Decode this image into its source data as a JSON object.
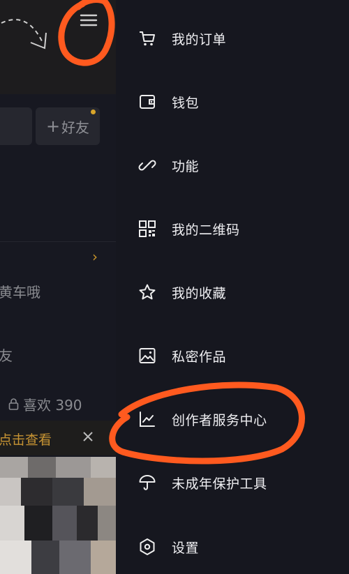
{
  "background": {
    "add_friend_label": "好友",
    "row1_text": "黄车哦",
    "row2_text": "友",
    "likes_text": "喜欢 390",
    "banner_text": "点击查看"
  },
  "drawer": {
    "items": [
      {
        "label": "我的订单",
        "icon": "shopping-cart-icon"
      },
      {
        "label": "钱包",
        "icon": "wallet-icon"
      },
      {
        "label": "功能",
        "icon": "link-icon"
      },
      {
        "label": "我的二维码",
        "icon": "qr-code-icon"
      },
      {
        "label": "我的收藏",
        "icon": "star-icon"
      },
      {
        "label": "私密作品",
        "icon": "image-icon"
      },
      {
        "label": "创作者服务中心",
        "icon": "chart-icon"
      },
      {
        "label": "未成年保护工具",
        "icon": "umbrella-icon"
      },
      {
        "label": "设置",
        "icon": "hexagon-settings-icon"
      }
    ]
  },
  "colors": {
    "drawer_bg": "#16171f",
    "annotation": "#ff5a1f",
    "accent": "#d9a52a"
  }
}
